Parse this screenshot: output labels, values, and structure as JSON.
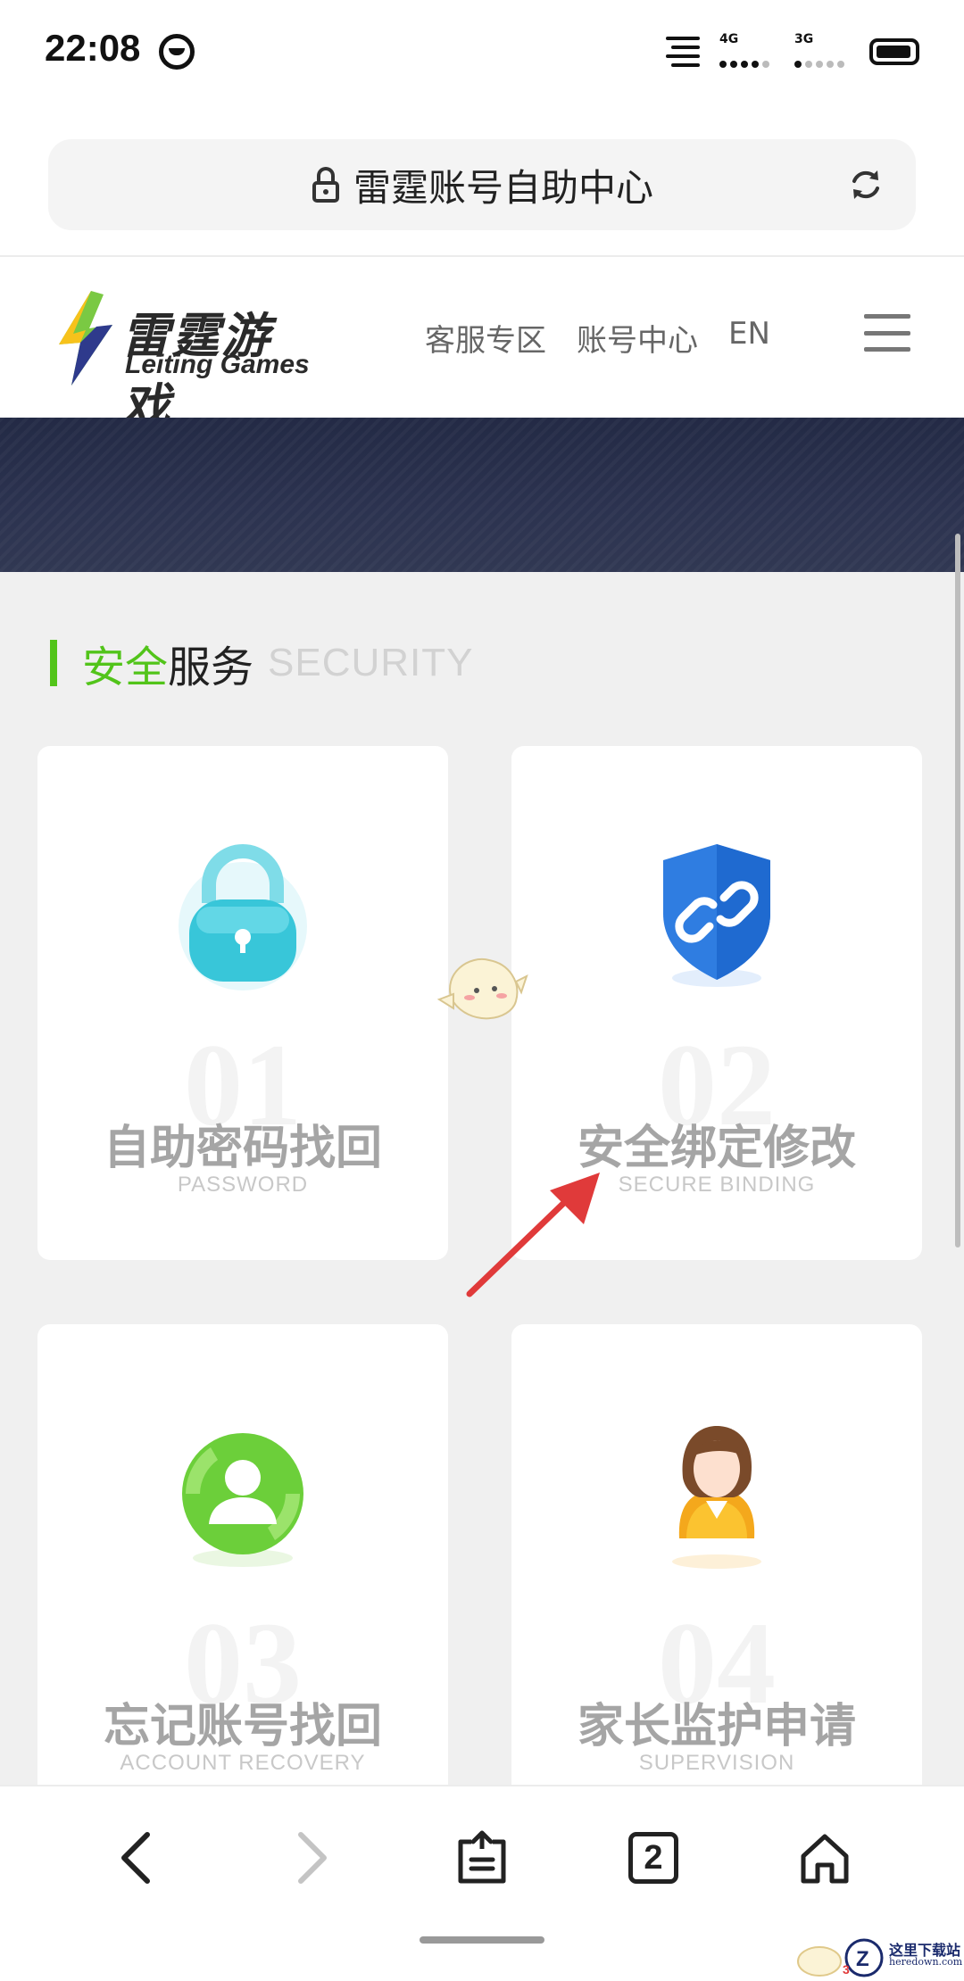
{
  "status_bar": {
    "time": "22:08",
    "net1": "4G",
    "net2": "3G",
    "icons": [
      "do-not-disturb-icon",
      "notification-lines-icon",
      "signal-4g-icon",
      "signal-3g-icon",
      "battery-icon"
    ]
  },
  "browser": {
    "url_title": "雷霆账号自助中心",
    "tabs_count": "2"
  },
  "site": {
    "logo_cn": "雷霆游戏",
    "logo_en": "Leiting Games",
    "nav": [
      "客服专区",
      "账号中心",
      "EN"
    ]
  },
  "section": {
    "title_green": "安全",
    "title_black": "服务",
    "title_en": "SECURITY"
  },
  "cards": [
    {
      "num": "01",
      "cn": "自助密码找回",
      "en": "PASSWORD",
      "icon": "lock-icon"
    },
    {
      "num": "02",
      "cn": "安全绑定修改",
      "en": "SECURE BINDING",
      "icon": "shield-link-icon"
    },
    {
      "num": "03",
      "cn": "忘记账号找回",
      "en": "ACCOUNT RECOVERY",
      "icon": "user-circle-icon"
    },
    {
      "num": "04",
      "cn": "家长监护申请",
      "en": "SUPERVISION",
      "icon": "parent-icon"
    }
  ],
  "watermark": {
    "text": "这里下载站",
    "sub": "heredown.com"
  },
  "colors": {
    "accent": "#52c41a",
    "banner": "#2a3048",
    "arrow": "#e03a3a",
    "shield": "#2f7de1",
    "lock": "#38c6d9",
    "user": "#6ccf3a"
  }
}
